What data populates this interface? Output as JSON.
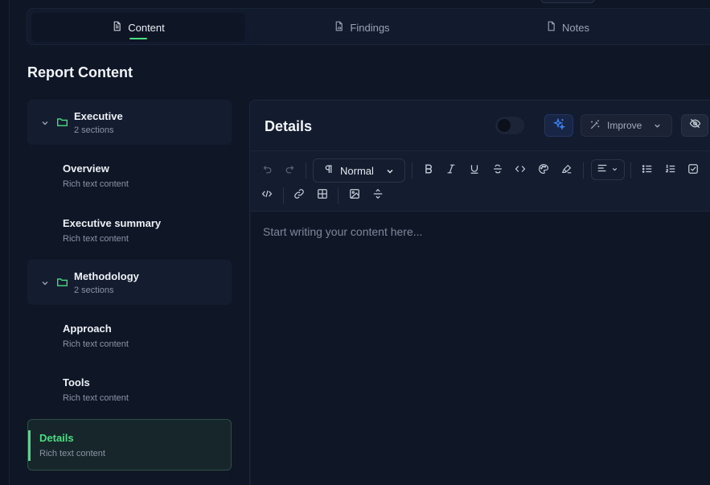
{
  "tabs": [
    {
      "label": "Content",
      "active": true,
      "icon": "document-icon"
    },
    {
      "label": "Findings",
      "active": false,
      "icon": "file-chart-icon"
    },
    {
      "label": "Notes",
      "active": false,
      "icon": "file-icon"
    }
  ],
  "sidebar": {
    "title": "Report Content",
    "groups": [
      {
        "title": "Executive",
        "subtitle": "2 sections",
        "items": [
          {
            "title": "Overview",
            "subtitle": "Rich text content"
          },
          {
            "title": "Executive summary",
            "subtitle": "Rich text content"
          }
        ]
      },
      {
        "title": "Methodology",
        "subtitle": "2 sections",
        "items": [
          {
            "title": "Approach",
            "subtitle": "Rich text content"
          },
          {
            "title": "Tools",
            "subtitle": "Rich text content"
          }
        ]
      }
    ],
    "active_item": {
      "title": "Details",
      "subtitle": "Rich text content"
    }
  },
  "editor": {
    "title": "Details",
    "improve_label": "Improve",
    "style_select": "Normal",
    "placeholder": "Start writing your content here..."
  },
  "colors": {
    "accent": "#4ade80",
    "ai_accent": "#3b82f6",
    "background": "#0f1626"
  }
}
